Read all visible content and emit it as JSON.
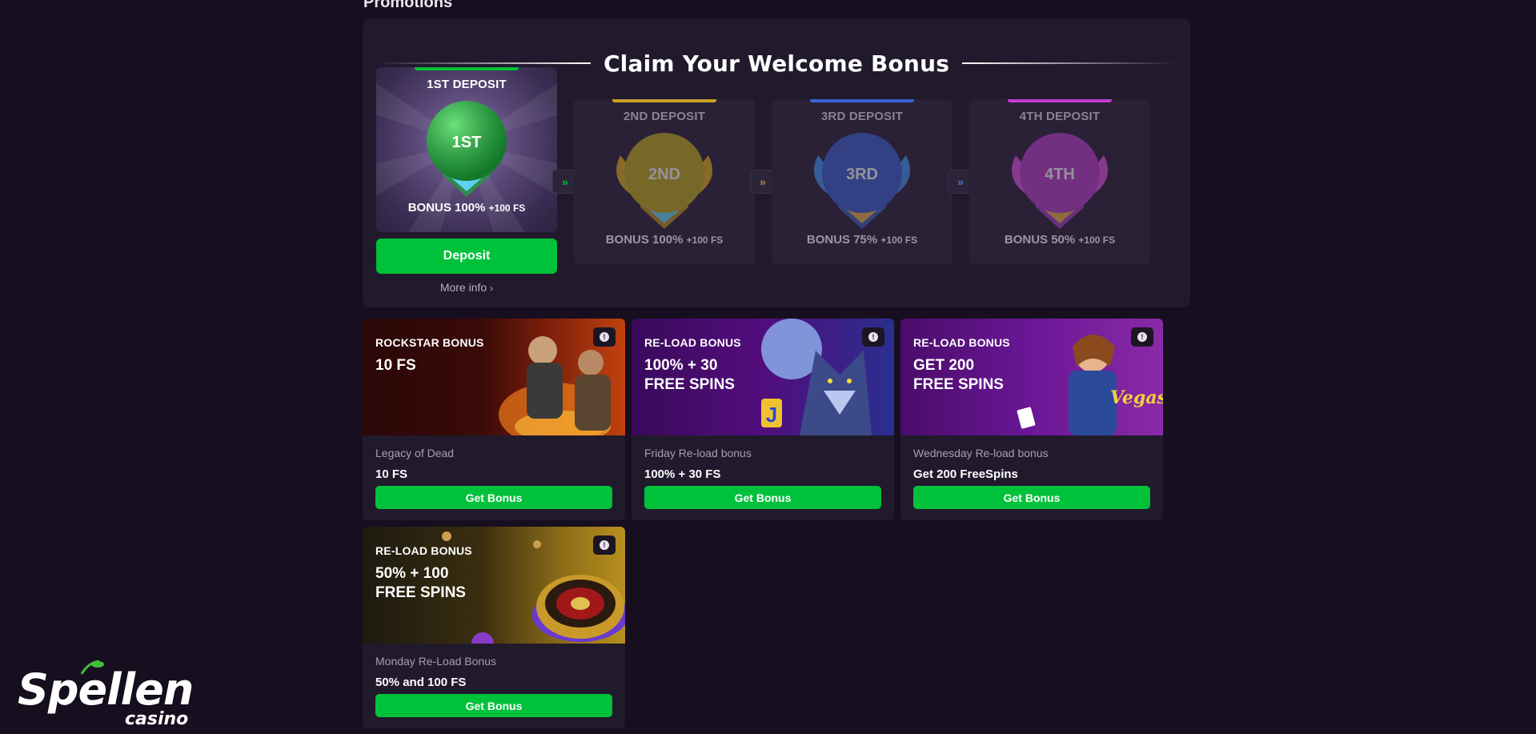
{
  "page": {
    "heading": "Promotions"
  },
  "welcome": {
    "title": "Claim Your Welcome Bonus",
    "deposits": [
      {
        "label": "1ST DEPOSIT",
        "badge": "1ST",
        "bonus": "BONUS 100%",
        "fs": "+100 FS",
        "accent": "#00c13a",
        "orb": "#1ea63a",
        "active": true
      },
      {
        "label": "2ND DEPOSIT",
        "badge": "2ND",
        "bonus": "BONUS 100%",
        "fs": "+100 FS",
        "accent": "#c9a227",
        "orb": "#b9a21d",
        "active": false
      },
      {
        "label": "3RD DEPOSIT",
        "badge": "3RD",
        "bonus": "BONUS 75%",
        "fs": "+100 FS",
        "accent": "#3b63d6",
        "orb": "#3b5bc4",
        "active": false
      },
      {
        "label": "4TH DEPOSIT",
        "badge": "4TH",
        "bonus": "BONUS 50%",
        "fs": "+100 FS",
        "accent": "#c23dd1",
        "orb": "#b03cbd",
        "active": false
      }
    ],
    "arrow_glyph": "»",
    "deposit_button": "Deposit",
    "more_info": "More info",
    "more_info_chevron": "›"
  },
  "promotions": [
    {
      "kicker": "ROCKSTAR BONUS",
      "headline": "10 FS",
      "game": "Legacy of Dead",
      "amount": "10 FS",
      "button": "Get Bonus",
      "theme": "rockstar"
    },
    {
      "kicker": "RE-LOAD BONUS",
      "headline": "100% + 30\nFREE SPINS",
      "game": "Friday Re-load bonus",
      "amount": "100% + 30 FS",
      "button": "Get Bonus",
      "theme": "wolf",
      "art_text": "J"
    },
    {
      "kicker": "RE-LOAD BONUS",
      "headline": "GET 200\nFREE SPINS",
      "game": "Wednesday Re-load bonus",
      "amount": "Get 200 FreeSpins",
      "button": "Get Bonus",
      "theme": "vegas",
      "art_text": "Vegas Magic"
    },
    {
      "kicker": "RE-LOAD BONUS",
      "headline": "50% + 100\nFREE SPINS",
      "game": "Monday Re-Load Bonus",
      "amount": "50% and 100 FS",
      "button": "Get Bonus",
      "theme": "roulette"
    }
  ],
  "info_glyph": "!",
  "logo": {
    "word": "Spellen",
    "sub": "casino"
  }
}
